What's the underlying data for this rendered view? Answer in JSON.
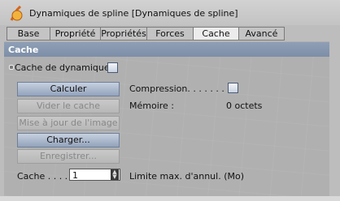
{
  "window": {
    "title": "Dynamiques de spline [Dynamiques de spline]"
  },
  "tabs": [
    {
      "label": "Base",
      "active": false
    },
    {
      "label": "Propriété",
      "active": false
    },
    {
      "label": "Propriétés",
      "active": false
    },
    {
      "label": "Forces",
      "active": false
    },
    {
      "label": "Cache",
      "active": true
    },
    {
      "label": "Avancé",
      "active": false
    }
  ],
  "section": {
    "title": "Cache"
  },
  "cache_dynamics": {
    "label": "Cache de dynamiques"
  },
  "buttons": {
    "calculate": "Calculer",
    "clear_cache": "Vider le cache",
    "update_image": "Mise à jour de l'image",
    "load": "Charger...",
    "save": "Enregistrer..."
  },
  "compression": {
    "label": "Compression. . . . . . . . ."
  },
  "memory": {
    "label": "Mémoire :",
    "value": "0 octets"
  },
  "cache_field": {
    "label": "Cache . . . .",
    "value": "1"
  },
  "undo_limit": {
    "label": "Limite max. d'annul. (Mo)"
  },
  "colors": {
    "section_header": "#8797b0",
    "button_active": "#a9b6ca",
    "panel_bg": "#b0b0b0"
  },
  "icons": {
    "logo": "cinema4d-logo-icon",
    "spinner": "up-down-arrows-icon",
    "section_dot": "bullet-icon"
  }
}
